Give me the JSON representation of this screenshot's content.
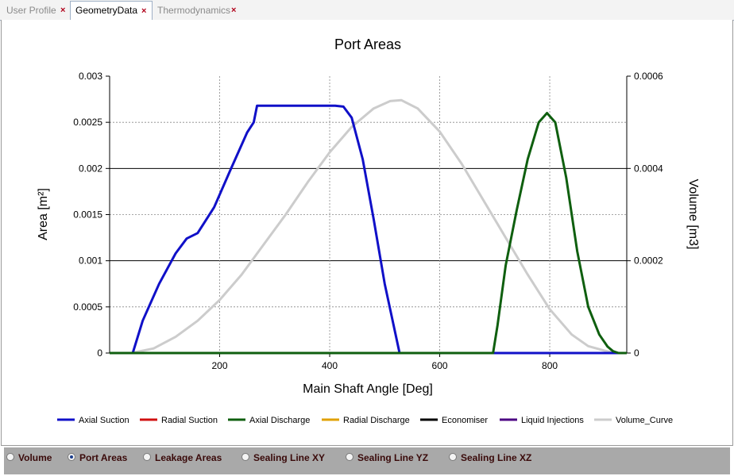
{
  "tabs": [
    {
      "label": "User Profile",
      "active": false
    },
    {
      "label": "GeometryData",
      "active": true
    },
    {
      "label": "Thermodynamics",
      "active": false
    }
  ],
  "close_glyph": "×",
  "chart_data": {
    "type": "line",
    "title": "Port Areas",
    "xlabel": "Main Shaft Angle [Deg]",
    "ylabel": "Area [m²]",
    "y2label": "Volume [m3]",
    "xlim": [
      0,
      940
    ],
    "xticks": [
      "200",
      "400",
      "600",
      "800"
    ],
    "ylim": [
      0,
      0.003
    ],
    "yticks": [
      "0",
      "0.0005",
      "0.001",
      "0.0015",
      "0.002",
      "0.0025",
      "0.003"
    ],
    "y2lim": [
      0,
      0.0006
    ],
    "y2ticks": [
      "0",
      "0.0002",
      "0.0004",
      "0.0006"
    ],
    "grid": true,
    "legend_position": "bottom",
    "series": [
      {
        "name": "Axial Suction",
        "color": "#1010c8",
        "axis": "left",
        "x": [
          0,
          42,
          60,
          90,
          120,
          140,
          160,
          190,
          220,
          250,
          262,
          268,
          300,
          350,
          410,
          425,
          440,
          460,
          480,
          500,
          527,
          540,
          940
        ],
        "y": [
          0,
          0,
          0.00035,
          0.00075,
          0.00108,
          0.00124,
          0.0013,
          0.00158,
          0.00199,
          0.00239,
          0.0025,
          0.00268,
          0.00268,
          0.00268,
          0.00268,
          0.00267,
          0.00255,
          0.0021,
          0.00145,
          0.00075,
          0,
          0,
          0
        ]
      },
      {
        "name": "Radial Suction",
        "color": "#d01010",
        "axis": "left",
        "x": [
          0,
          940
        ],
        "y": [
          0,
          0
        ]
      },
      {
        "name": "Axial Discharge",
        "color": "#0f5f0f",
        "axis": "left",
        "x": [
          0,
          697,
          705,
          720,
          740,
          760,
          780,
          795,
          810,
          830,
          850,
          870,
          890,
          905,
          915,
          925,
          940
        ],
        "y": [
          0,
          0,
          0.0003,
          0.00095,
          0.00155,
          0.0021,
          0.0025,
          0.0026,
          0.0025,
          0.0019,
          0.0011,
          0.0005,
          0.0002,
          7e-05,
          2e-05,
          0,
          0
        ]
      },
      {
        "name": "Radial Discharge",
        "color": "#e0a000",
        "axis": "left",
        "x": [
          0,
          940
        ],
        "y": [
          0,
          0
        ]
      },
      {
        "name": "Economiser",
        "color": "#000000",
        "axis": "left",
        "x": [
          0,
          940
        ],
        "y": [
          0,
          0
        ]
      },
      {
        "name": "Liquid Injections",
        "color": "#4b0082",
        "axis": "left",
        "x": [
          0,
          940
        ],
        "y": [
          0,
          0
        ]
      },
      {
        "name": "Volume_Curve",
        "color": "#cccccc",
        "axis": "right",
        "x": [
          0,
          40,
          80,
          120,
          160,
          200,
          240,
          280,
          320,
          360,
          400,
          440,
          480,
          510,
          530,
          560,
          600,
          640,
          680,
          720,
          760,
          800,
          840,
          870,
          900,
          920,
          940
        ],
        "y": [
          0,
          0,
          1e-05,
          3.5e-05,
          7e-05,
          0.000115,
          0.00017,
          0.000235,
          0.0003,
          0.00037,
          0.000435,
          0.00049,
          0.00053,
          0.000546,
          0.000548,
          0.00053,
          0.00048,
          0.00041,
          0.00033,
          0.00025,
          0.00017,
          9.5e-05,
          4e-05,
          1.5e-05,
          5e-06,
          0,
          0
        ]
      }
    ]
  },
  "radio_options": [
    {
      "label": "Volume",
      "selected": false
    },
    {
      "label": "Port Areas",
      "selected": true
    },
    {
      "label": "Leakage Areas",
      "selected": false
    },
    {
      "label": "Sealing Line XY",
      "selected": false
    },
    {
      "label": "Sealing Line YZ",
      "selected": false
    },
    {
      "label": "Sealing Line XZ",
      "selected": false
    }
  ]
}
